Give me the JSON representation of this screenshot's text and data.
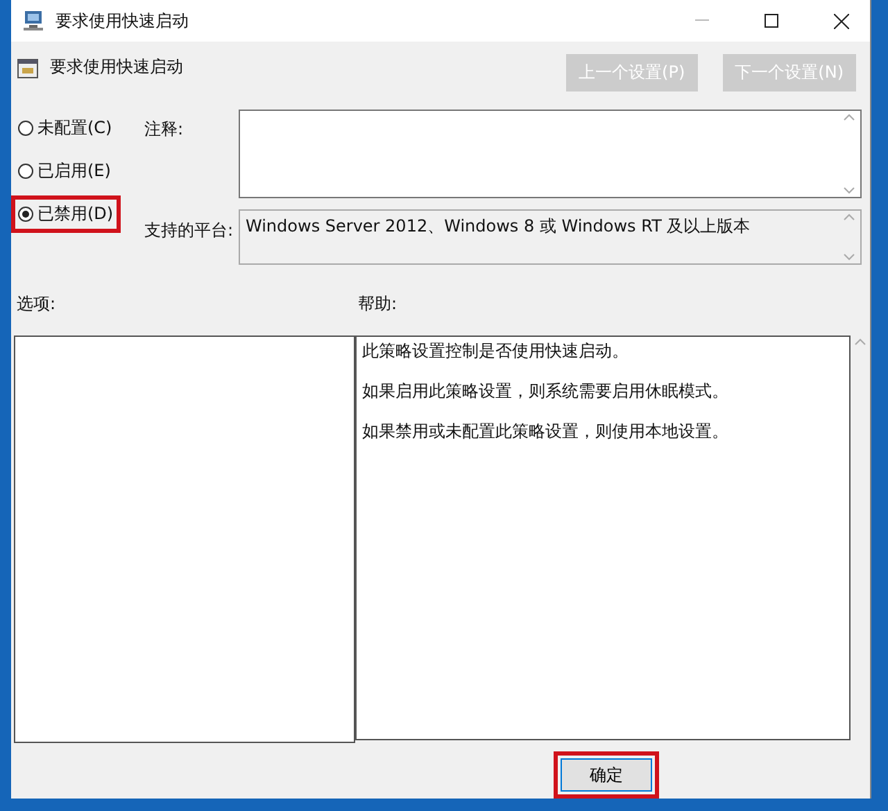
{
  "window": {
    "title": "要求使用快速启动"
  },
  "header": {
    "title": "要求使用快速启动"
  },
  "nav_buttons": [
    {
      "label": "上一个设置(P)",
      "disabled": true
    },
    {
      "label": "下一个设置(N)",
      "disabled": true
    }
  ],
  "options": [
    {
      "label": "未配置(C)",
      "selected": false,
      "highlighted": false
    },
    {
      "label": "已启用(E)",
      "selected": false,
      "highlighted": false
    },
    {
      "label": "已禁用(D)",
      "selected": true,
      "highlighted": true
    }
  ],
  "comment": {
    "label": "注释:"
  },
  "platform": {
    "label": "支持的平台:",
    "value": "Windows Server 2012、Windows 8 或 Windows RT 及以上版本"
  },
  "options_pane": {
    "label": "选项:"
  },
  "help_pane": {
    "label": "帮助:",
    "paragraphs": [
      "此策略设置控制是否使用快速启动。",
      "如果启用此策略设置，则系统需要启用休眠模式。",
      "如果禁用或未配置此策略设置，则使用本地设置。"
    ]
  },
  "buttons": [
    {
      "label": "确定",
      "highlighted": true
    }
  ]
}
